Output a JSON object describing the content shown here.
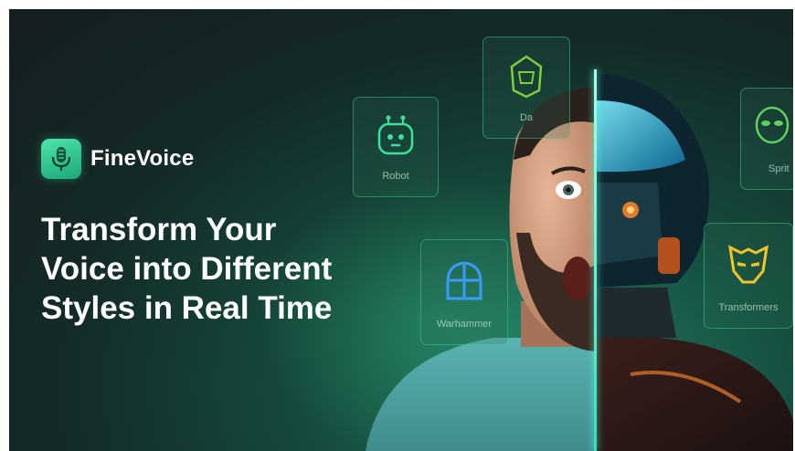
{
  "brand": {
    "name": "FineVoice",
    "logo_icon": "microphone-icon"
  },
  "headline": {
    "lines": [
      "Transform Your",
      "Voice into Different",
      "Styles in Real Time"
    ]
  },
  "voice_cards": [
    {
      "label": "Robot",
      "icon": "robot-icon"
    },
    {
      "label": "Da",
      "icon": "helmet-icon"
    },
    {
      "label": "Warhammer",
      "icon": "knight-helmet-icon"
    },
    {
      "label": "Sprit",
      "icon": "alien-icon"
    },
    {
      "label": "Transformers",
      "icon": "transformer-mask-icon"
    }
  ],
  "colors": {
    "accent": "#3ee0a0",
    "background": "#151d1f",
    "glow": "#1f7a60"
  }
}
